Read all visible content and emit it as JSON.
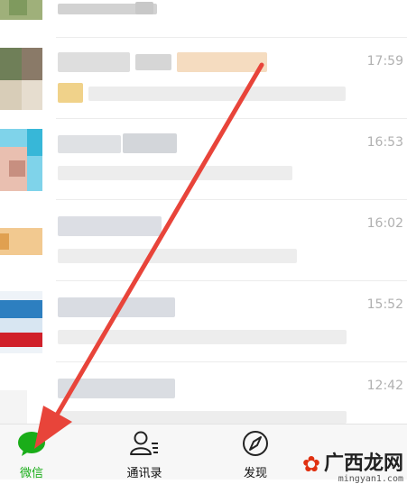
{
  "chat_list": {
    "rows": [
      {
        "time": ""
      },
      {
        "time": "17:59"
      },
      {
        "time": "16:53"
      },
      {
        "time": "16:02"
      },
      {
        "time": "15:52"
      },
      {
        "time": "12:42"
      }
    ]
  },
  "tab_bar": {
    "tabs": [
      {
        "label": "微信",
        "icon": "chat-bubble-icon",
        "active": true
      },
      {
        "label": "通讯录",
        "icon": "contacts-icon",
        "active": false
      },
      {
        "label": "发现",
        "icon": "compass-icon",
        "active": false
      }
    ]
  },
  "watermark": {
    "text": "广西龙网",
    "url": "mingyan1.com"
  },
  "colors": {
    "accent": "#1aad19",
    "arrow": "#e8443a"
  }
}
